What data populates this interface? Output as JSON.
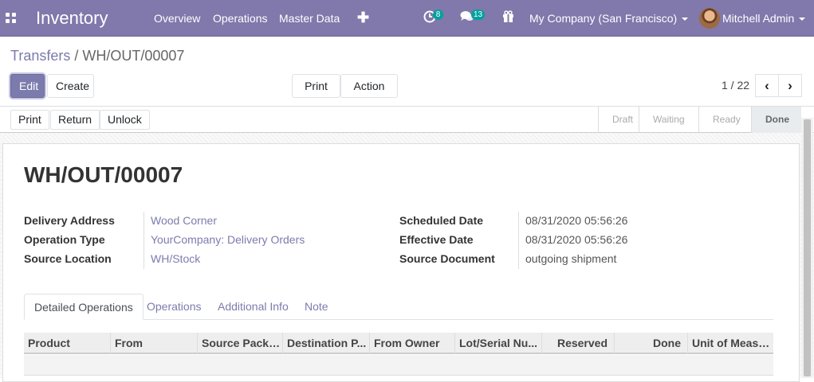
{
  "topbar": {
    "app_name": "Inventory",
    "menu": [
      "Overview",
      "Operations",
      "Master Data"
    ],
    "plus": "✚",
    "activity_badge": "8",
    "messages_badge": "13",
    "company": "My Company (San Francisco)",
    "user": "Mitchell Admin",
    "color": "#8178ab"
  },
  "breadcrumb": {
    "parent": "Transfers",
    "separator": "/",
    "current": "WH/OUT/00007"
  },
  "buttons": {
    "edit": "Edit",
    "create": "Create",
    "print": "Print",
    "action": "Action"
  },
  "pager": {
    "value": "1 / 22",
    "prev": "‹",
    "next": "›"
  },
  "statusbar": {
    "buttons": [
      "Print",
      "Return",
      "Unlock"
    ],
    "stages": [
      "Draft",
      "Waiting",
      "Ready",
      "Done"
    ],
    "active_stage": "Done"
  },
  "record": {
    "title": "WH/OUT/00007",
    "left_fields": [
      {
        "label": "Delivery Address",
        "value": "Wood Corner"
      },
      {
        "label": "Operation Type",
        "value": "YourCompany: Delivery Orders"
      },
      {
        "label": "Source Location",
        "value": "WH/Stock"
      }
    ],
    "right_fields": [
      {
        "label": "Scheduled Date",
        "value": "08/31/2020 05:56:26"
      },
      {
        "label": "Effective Date",
        "value": "08/31/2020 05:56:26"
      },
      {
        "label": "Source Document",
        "value": "outgoing shipment"
      }
    ]
  },
  "tabs": [
    "Detailed Operations",
    "Operations",
    "Additional Info",
    "Note"
  ],
  "table": {
    "columns": [
      "Product",
      "From",
      "Source Packa...",
      "Destination P...",
      "From Owner",
      "Lot/Serial Nu...",
      "Reserved",
      "Done",
      "Unit of Measu..."
    ]
  },
  "colors": {
    "brand": "#8178ab",
    "link": "#7c7bad"
  }
}
